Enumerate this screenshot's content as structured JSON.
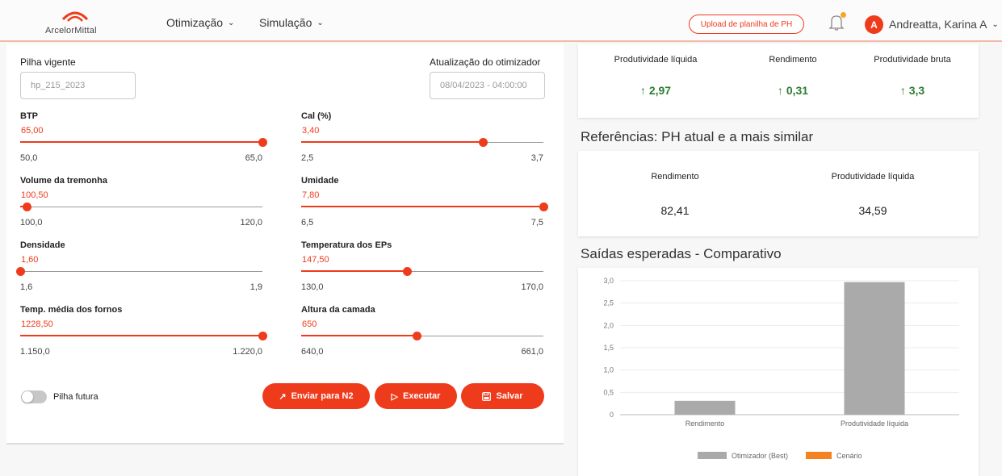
{
  "header": {
    "logo_text": "ArcelorMittal",
    "nav": [
      {
        "label": "Otimização"
      },
      {
        "label": "Simulação"
      }
    ],
    "upload_label": "Upload de planilha de PH",
    "avatar_initial": "A",
    "user_name": "Andreatta, Karina A"
  },
  "form": {
    "pilha_label": "Pilha vigente",
    "pilha_value": "hp_215_2023",
    "atualizacao_label": "Atualização do otimizador",
    "atualizacao_value": "08/04/2023 - 04:00:00",
    "sliders": [
      {
        "title": "BTP",
        "value": "65,00",
        "min": "50,0",
        "max": "65,0",
        "fraction": 1.0
      },
      {
        "title": "Cal (%)",
        "value": "3,40",
        "min": "2,5",
        "max": "3,7",
        "fraction": 0.75
      },
      {
        "title": "Volume da tremonha",
        "value": "100,50",
        "min": "100,0",
        "max": "120,0",
        "fraction": 0.025
      },
      {
        "title": "Umidade",
        "value": "7,80",
        "min": "6,5",
        "max": "7,5",
        "fraction": 1.0
      },
      {
        "title": "Densidade",
        "value": "1,60",
        "min": "1,6",
        "max": "1,9",
        "fraction": 0.0
      },
      {
        "title": "Temperatura dos EPs",
        "value": "147,50",
        "min": "130,0",
        "max": "170,0",
        "fraction": 0.4375
      },
      {
        "title": "Temp. média dos fornos",
        "value": "1228,50",
        "min": "1.150,0",
        "max": "1.220,0",
        "fraction": 1.0
      },
      {
        "title": "Altura da camada",
        "value": "650",
        "min": "640,0",
        "max": "661,0",
        "fraction": 0.476
      }
    ],
    "toggle_label": "Pilha futura",
    "buttons": {
      "send": "Enviar para N2",
      "run": "Executar",
      "save": "Salvar"
    }
  },
  "kpis": [
    {
      "label": "Produtividade líquida",
      "value": "2,97"
    },
    {
      "label": "Rendimento",
      "value": "0,31"
    },
    {
      "label": "Produtividade bruta",
      "value": "3,3"
    }
  ],
  "references": {
    "title": "Referências: PH atual e a mais similar",
    "items": [
      {
        "label": "Rendimento",
        "value": "82,41"
      },
      {
        "label": "Produtividade líquida",
        "value": "34,59"
      }
    ]
  },
  "comparison_title": "Saídas esperadas - Comparativo",
  "colors": {
    "accent": "#ee3b1c",
    "positive": "#2e7d32",
    "bar_best": "#aaaaaa",
    "bar_scenario": "#f58220"
  },
  "chart_data": {
    "type": "bar",
    "categories": [
      "Rendimento",
      "Produtividade líquida"
    ],
    "series": [
      {
        "name": "Otimizador (Best)",
        "values": [
          0.31,
          2.97
        ]
      },
      {
        "name": "Cenário",
        "values": [
          0,
          0
        ]
      }
    ],
    "yticks": [
      "0",
      "0,5",
      "1,0",
      "1,5",
      "2,0",
      "2,5",
      "3,0"
    ],
    "ylim": [
      0,
      3.0
    ],
    "legend_position": "bottom",
    "grid": true
  }
}
